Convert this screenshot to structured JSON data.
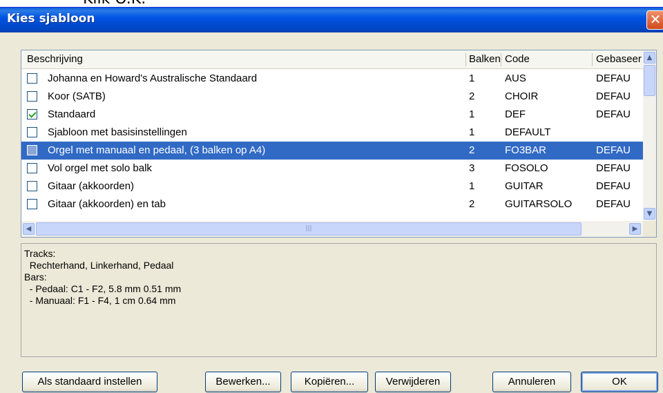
{
  "background": {
    "bullet": "•",
    "text": "Klik O.K."
  },
  "window": {
    "title": "Kies sjabloon",
    "close_glyph": "✕"
  },
  "table": {
    "columns": [
      "Beschrijving",
      "Balken",
      "Code",
      "Gebaseerd"
    ],
    "rows": [
      {
        "checked": false,
        "selected": false,
        "description": "Johanna en Howard's Australische Standaard",
        "balken": "1",
        "code": "AUS",
        "gebaseerd": "DEFAU"
      },
      {
        "checked": false,
        "selected": false,
        "description": "Koor (SATB)",
        "balken": "2",
        "code": "CHOIR",
        "gebaseerd": "DEFAU"
      },
      {
        "checked": true,
        "selected": false,
        "description": "Standaard",
        "balken": "1",
        "code": "DEF",
        "gebaseerd": "DEFAU"
      },
      {
        "checked": false,
        "selected": false,
        "description": "Sjabloon met basisinstellingen",
        "balken": "1",
        "code": "DEFAULT",
        "gebaseerd": ""
      },
      {
        "checked": false,
        "selected": true,
        "description": "Orgel met manuaal en pedaal, (3 balken op A4)",
        "balken": "2",
        "code": "FO3BAR",
        "gebaseerd": "DEFAU"
      },
      {
        "checked": false,
        "selected": false,
        "description": "Vol orgel met solo balk",
        "balken": "3",
        "code": "FOSOLO",
        "gebaseerd": "DEFAU"
      },
      {
        "checked": false,
        "selected": false,
        "description": "Gitaar (akkoorden)",
        "balken": "1",
        "code": "GUITAR",
        "gebaseerd": "DEFAU"
      },
      {
        "checked": false,
        "selected": false,
        "description": "Gitaar (akkoorden) en tab",
        "balken": "2",
        "code": "GUITARSOLO",
        "gebaseerd": "DEFAU"
      }
    ]
  },
  "scroll": {
    "up": "▲",
    "down": "▼",
    "left": "◀",
    "right": "▶",
    "grip": "|||"
  },
  "details": {
    "lines": [
      "Tracks:",
      "  Rechterhand, Linkerhand, Pedaal",
      "Bars:",
      "  - Pedaal: C1 - F2, 5.8 mm 0.51 mm",
      "  - Manuaal: F1 - F4, 1 cm 0.64 mm"
    ]
  },
  "buttons": {
    "set_default": "Als standaard instellen",
    "edit": "Bewerken...",
    "copy": "Kopiëren...",
    "delete": "Verwijderen",
    "cancel": "Annuleren",
    "ok": "OK"
  }
}
